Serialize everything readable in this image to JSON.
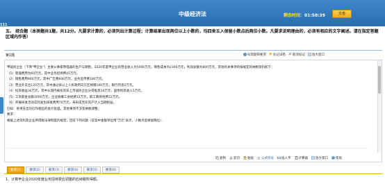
{
  "header": {
    "title": "中级经济法",
    "timer_label": "剩余时间：",
    "timer_value": "01:58:39",
    "submit_label": "交卷",
    "question_number": "111"
  },
  "section": {
    "heading": "五、 综合题（本类题共1题，共12分。凡要求计算的，必须列出计算过程；计算结果出现两位以上小数的，均四舍五入保留小数点后两位小数。凡要求说明理由的，必须有相应的文字阐述。请在指定答题区域内作答）"
  },
  "question": {
    "label": "第1题",
    "toolbar_top": [
      "纠错题目要求",
      "标记试卷",
      "取消标记",
      "放大窗口"
    ],
    "case_lines": [
      "甲居民企业（下简\"甲企业\"）主要从事家用电器的生产与销售，2020年度甲企业的营业收入为5000万元，销售成本为2300万元，利润总额为800万元，其他有关事项的按规定的纳税资料如下：",
      "（1）管理费用为60万元，其中业务招待费45万元。",
      "（2）销售费用900万元，其中广告费600万元、业务宣传费180万元。",
      "（3）营业外支出120万元，其中通过县以上人民政府向灾区捐赠100万元，银行罚息2万元。",
      "（4）投资收益30万元，其中从境内被投资非上市居民企业分得股息10万元，国债利息收入5万元。",
      "（5）工资薪金总额3000万元，企业拨缴工会经费12万元，职工教育经费22万元。",
      "（6）开展研发活动实际发生研发费用70万元，未形成无形资产计入当期损益。",
      "已知：各项支出均已作相应的会计处理，其他事项不涉及纳税调整。",
      "要求：",
      "根据上述资料及企业所得税法律制度的规定，回答下列问题（答案中金额单位用\"万元\"表示，小数点后保留两位）："
    ],
    "toolbar_bottom": [
      "复制",
      "剪切",
      "粘贴",
      "公式符号",
      "插入字",
      "计算器",
      "放大窗口",
      "帮助"
    ],
    "tabs": [
      "要求(1)",
      "要求(2)",
      "要求(3)",
      "要求(4)",
      "要求(5)",
      "要求(6)"
    ],
    "active_tab": 0,
    "sub_question": "1、计算甲企业2020年度业务招待费应调整的应纳税所得额。"
  },
  "colors": {
    "header_blue": "#2a6eb0",
    "accent_orange": "#f0a818",
    "timer_yellow": "#ffe033"
  }
}
